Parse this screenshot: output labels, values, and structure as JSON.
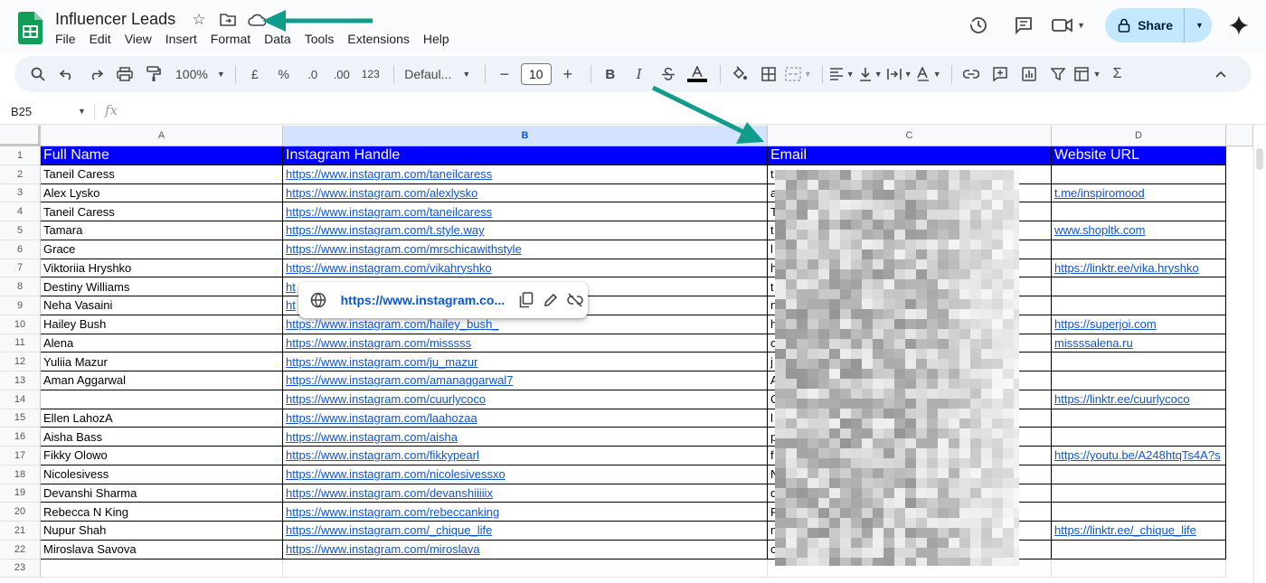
{
  "app": {
    "doc_title": "Influencer Leads",
    "menu": [
      "File",
      "Edit",
      "View",
      "Insert",
      "Format",
      "Data",
      "Tools",
      "Extensions",
      "Help"
    ],
    "share_label": "Share",
    "colors": {
      "accent": "#0b57d0",
      "header_fill": "#0000ff",
      "link": "#1155cc",
      "share_bg": "#c2e7ff",
      "annotation_arrow": "#119c8c"
    }
  },
  "toolbar": {
    "zoom": "100%",
    "currency": "£",
    "percent": "%",
    "dec_decrease": ".0",
    "dec_increase": ".00",
    "number_format": "123",
    "font_name": "Defaul...",
    "font_size": "10",
    "bold": "B",
    "italic": "I",
    "sigma": "Σ"
  },
  "formula_bar": {
    "name_box": "B25",
    "fx": "fx"
  },
  "grid": {
    "columns": [
      "A",
      "B",
      "C",
      "D"
    ],
    "headers": [
      "Full Name",
      "Instagram Handle",
      "Email",
      "Website URL"
    ],
    "row_numbers": [
      "1",
      "2",
      "3",
      "4",
      "5",
      "6",
      "7",
      "8",
      "9",
      "10",
      "11",
      "12",
      "13",
      "14",
      "15",
      "16",
      "17",
      "18",
      "19",
      "20",
      "21",
      "22",
      "23"
    ],
    "rows": [
      {
        "name": "Taneil Caress",
        "handle": "https://www.instagram.com/taneilcaress",
        "email": "t",
        "site": ""
      },
      {
        "name": "Alex Lysko",
        "handle": "https://www.instagram.com/alexlysko",
        "email": "a",
        "site": "t.me/inspiromood"
      },
      {
        "name": "Taneil Caress",
        "handle": "https://www.instagram.com/taneilcaress",
        "email": "T",
        "site": ""
      },
      {
        "name": "Tamara",
        "handle": "https://www.instagram.com/t.style.way",
        "email": "t",
        "site": "www.shopltk.com"
      },
      {
        "name": "Grace",
        "handle": "https://www.instagram.com/mrschicawithstyle",
        "email": "l",
        "site": ""
      },
      {
        "name": "Viktoriia Hryshko",
        "handle": "https://www.instagram.com/vikahryshko",
        "email": "h",
        "site": "https://linktr.ee/vika.hryshko"
      },
      {
        "name": "Destiny Williams",
        "handle": "ht",
        "email": "t",
        "site": ""
      },
      {
        "name": "Neha Vasaini",
        "handle": "ht",
        "email": "n",
        "site": ""
      },
      {
        "name": "Hailey Bush",
        "handle": "https://www.instagram.com/hailey_bush_",
        "email": "h",
        "site": "https://superjoi.com"
      },
      {
        "name": "Alena",
        "handle": "https://www.instagram.com/misssss",
        "email": "c",
        "site": "missssalena.ru"
      },
      {
        "name": "Yuliia Mazur",
        "handle": "https://www.instagram.com/ju_mazur",
        "email": "j",
        "site": ""
      },
      {
        "name": "Aman Aggarwal",
        "handle": "https://www.instagram.com/amanaggarwal7",
        "email": "A",
        "site": ""
      },
      {
        "name": "",
        "handle": "https://www.instagram.com/cuurlycoco",
        "email": "C",
        "site": "https://linktr.ee/cuurlycoco"
      },
      {
        "name": "Ellen LahozA",
        "handle": "https://www.instagram.com/laahozaa",
        "email": "l",
        "site": ""
      },
      {
        "name": "Aisha Bass",
        "handle": "https://www.instagram.com/aisha",
        "email": "p",
        "site": ""
      },
      {
        "name": "Fikky Olowo",
        "handle": "https://www.instagram.com/fikkypearl",
        "email": "f",
        "site": "https://youtu.be/A248htqTs4A?s"
      },
      {
        "name": "Nicolesivess",
        "handle": "https://www.instagram.com/nicolesivessxo",
        "email": "N",
        "site": ""
      },
      {
        "name": "Devanshi Sharma",
        "handle": "https://www.instagram.com/devanshiiiiix",
        "email": "d",
        "site": ""
      },
      {
        "name": "Rebecca N King",
        "handle": "https://www.instagram.com/rebeccanking",
        "email": "F",
        "site": ""
      },
      {
        "name": "Nupur Shah",
        "handle": "https://www.instagram.com/_chique_life",
        "email": "n",
        "site": "https://linktr.ee/_chique_life"
      },
      {
        "name": "Miroslava Savova",
        "handle": "https://www.instagram.com/miroslava",
        "email": "c",
        "site": ""
      }
    ]
  },
  "link_popup": {
    "url": "https://www.instagram.co...",
    "icons": [
      "globe-icon",
      "copy-icon",
      "edit-icon",
      "unlink-icon"
    ]
  }
}
